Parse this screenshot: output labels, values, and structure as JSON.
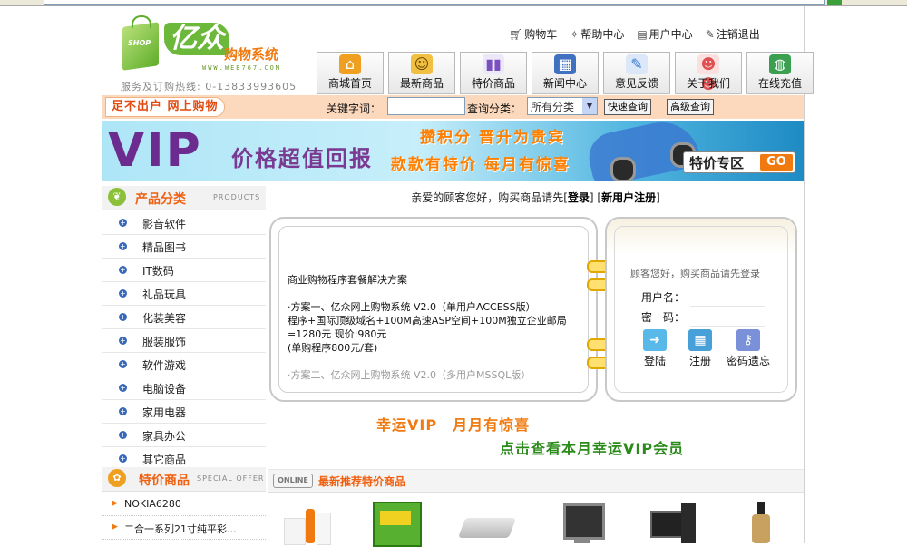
{
  "brand": {
    "name": "亿众",
    "subtitle": "购物系统",
    "url": "WWW.WEB767.COM",
    "bag_text": "SHOP",
    "hotline": "服务及订购热线: 0-13833993605"
  },
  "toplinks": [
    {
      "label": "购物车",
      "icon": "cart-icon"
    },
    {
      "label": "帮助中心",
      "icon": "help-icon"
    },
    {
      "label": "用户中心",
      "icon": "document-icon"
    },
    {
      "label": "注销退出",
      "icon": "logout-icon"
    }
  ],
  "nav": [
    {
      "label": "商城首页",
      "icon": "home-icon",
      "color": "#f0a020"
    },
    {
      "label": "最新商品",
      "icon": "face-icon",
      "color": "#f2c040"
    },
    {
      "label": "特价商品",
      "icon": "bar-chart-icon",
      "color": "#7a50c0"
    },
    {
      "label": "新闻中心",
      "icon": "newspaper-icon",
      "color": "#4070c0"
    },
    {
      "label": "意见反馈",
      "icon": "pen-icon",
      "color": "#3a7ad0"
    },
    {
      "label": "关于我们",
      "icon": "people-icon",
      "color": "#e05050"
    },
    {
      "label": "在线充值",
      "icon": "globe-icon",
      "color": "#3aa050"
    }
  ],
  "search": {
    "slogan": "足不出户 网上购物",
    "keyword_label": "关键字词：",
    "keyword_value": "",
    "category_label": "查询分类：",
    "category_selected": "所有分类",
    "quick_button": "快速查询",
    "advanced_button": "高级查询"
  },
  "banner": {
    "vip": "VIP",
    "tagline": "价格超值回报",
    "line1": "攒积分 晋升为贵宾",
    "line2": "款款有特价 每月有惊喜",
    "go_label": "特价专区",
    "go_btn": "GO"
  },
  "categories_head": {
    "title": "产品分类",
    "en": "PRODUCTS"
  },
  "categories": [
    "影音软件",
    "精品图书",
    "IT数码",
    "礼品玩具",
    "化装美容",
    "服装服饰",
    "软件游戏",
    "电脑设备",
    "家用电器",
    "家具办公",
    "其它商品"
  ],
  "specials_head": {
    "title": "特价商品",
    "en": "SPECIAL OFFER"
  },
  "specials": [
    "NOKIA6280",
    "二合一系列21寸纯平彩..."
  ],
  "welcome": {
    "prefix": "亲爱的顾客您好，购买商品请先[",
    "login": "登录",
    "mid": "] [",
    "register": "新用户注册",
    "suffix": "]"
  },
  "notice": {
    "title": "商业购物程序套餐解决方案",
    "line1": "·方案一、亿众网上购物系统 V2.0（单用户ACCESS版）",
    "line2": "程序+国际顶级域名+100M高速ASP空间+100M独立企业邮局",
    "line3": "=1280元 现价:980元",
    "line4": "(单购程序800元/套)",
    "line5": "·方案二、亿众网上购物系统 V2.0（多用户MSSQL版）"
  },
  "login": {
    "message": "顾客您好，购买商品请先登录",
    "username_label": "用户名：",
    "password_label": "密　码：",
    "login_button": "登陆",
    "register_button": "注册",
    "forgot_button": "密码遗忘"
  },
  "lucky": {
    "line1": "幸运VIP　月月有惊喜",
    "line2": "点击查看本月幸运VIP会员"
  },
  "recommend": {
    "badge": "ONLINE",
    "title": "最新推荐特价商品"
  }
}
